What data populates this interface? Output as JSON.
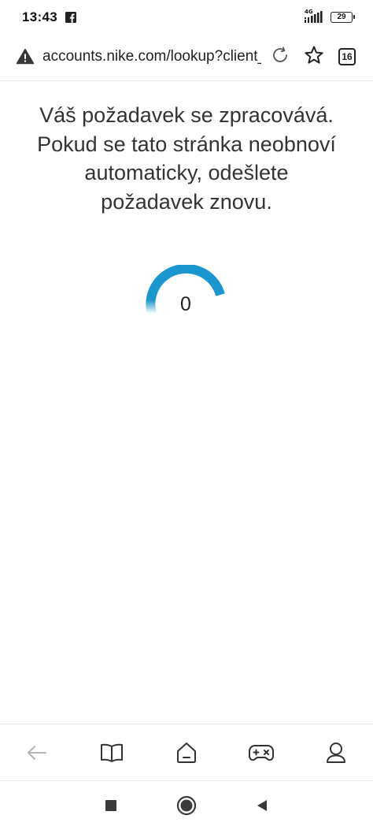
{
  "status_bar": {
    "time": "13:43",
    "network": "4G",
    "battery": "29",
    "icons": [
      "facebook-icon",
      "signal-icon",
      "battery-icon"
    ]
  },
  "address_bar": {
    "url": "accounts.nike.com/lookup?client_",
    "tab_count": "16",
    "icons": [
      "warning-icon",
      "reload-icon",
      "star-icon",
      "tabs-icon"
    ]
  },
  "content": {
    "message": "Váš požadavek se zpracovává. Pokud se tato stránka neobnoví automaticky, odešlete požadavek znovu.",
    "counter": "0",
    "accent_color": "#1b97cf"
  },
  "browser_nav": {
    "icons": [
      "back-arrow-icon",
      "bookmarks-icon",
      "home-icon",
      "games-icon",
      "profile-icon"
    ]
  },
  "system_nav": {
    "icons": [
      "recents-icon",
      "home-circle-icon",
      "back-triangle-icon"
    ]
  }
}
